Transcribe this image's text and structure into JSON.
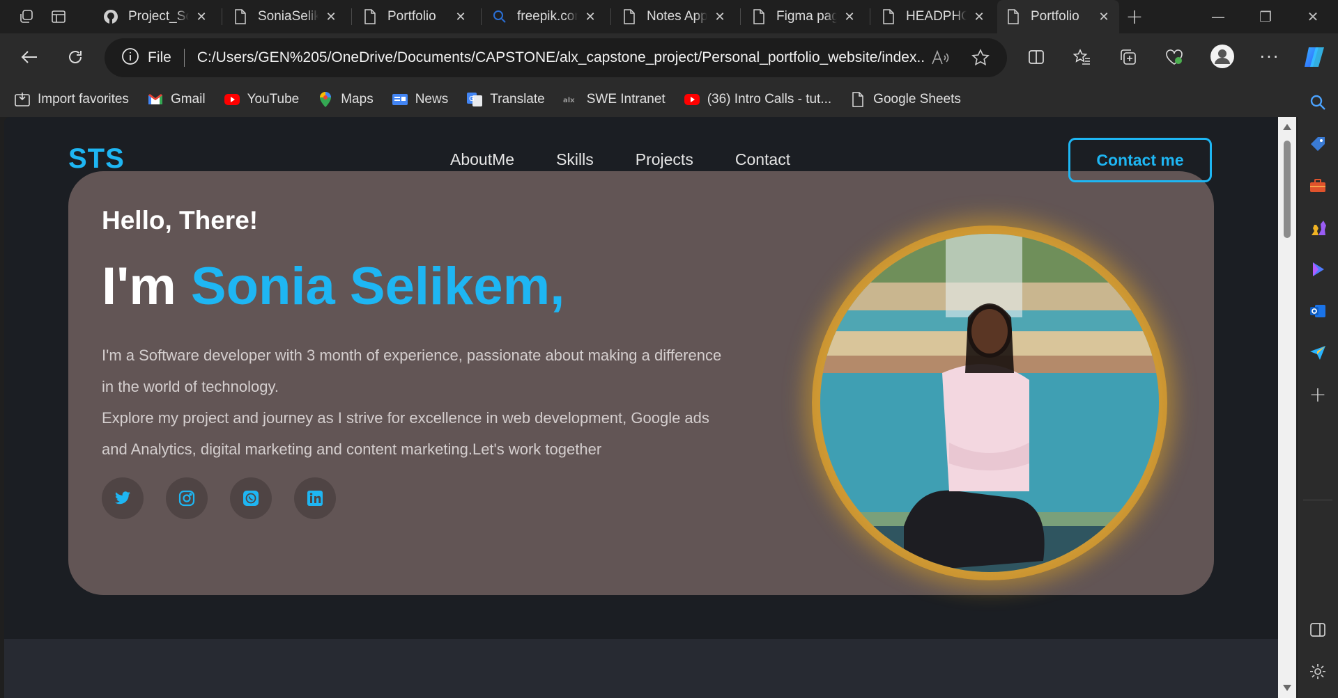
{
  "browser": {
    "tabs": [
      {
        "title": "Project_So",
        "icon": "github-icon",
        "active": false
      },
      {
        "title": "SoniaSelik",
        "icon": "page-icon",
        "active": false
      },
      {
        "title": "Portfolio",
        "icon": "page-icon",
        "active": false
      },
      {
        "title": "freepik.com",
        "icon": "search-icon",
        "active": false
      },
      {
        "title": "Notes App",
        "icon": "page-icon",
        "active": false
      },
      {
        "title": "Figma pag",
        "icon": "page-icon",
        "active": false
      },
      {
        "title": "HEADPHO",
        "icon": "page-icon",
        "active": false
      },
      {
        "title": "Portfolio",
        "icon": "page-icon",
        "active": true
      }
    ],
    "address": {
      "scheme_label": "File",
      "url": "C:/Users/GEN%205/OneDrive/Documents/CAPSTONE/alx_capstone_project/Personal_portfolio_website/index..."
    },
    "bookmarks": [
      {
        "label": "Import favorites",
        "icon": "import-icon"
      },
      {
        "label": "Gmail",
        "icon": "gmail-icon"
      },
      {
        "label": "YouTube",
        "icon": "youtube-icon"
      },
      {
        "label": "Maps",
        "icon": "maps-icon"
      },
      {
        "label": "News",
        "icon": "news-icon"
      },
      {
        "label": "Translate",
        "icon": "translate-icon"
      },
      {
        "label": "SWE Intranet",
        "icon": "alx-icon"
      },
      {
        "label": "(36) Intro Calls - tut...",
        "icon": "youtube-icon"
      },
      {
        "label": "Google Sheets",
        "icon": "page-icon"
      }
    ]
  },
  "site": {
    "logo": "STS",
    "nav": [
      "AboutMe",
      "Skills",
      "Projects",
      "Contact"
    ],
    "contact_button": "Contact me",
    "hero": {
      "greeting": "Hello, There!",
      "im": "I'm",
      "name": "Sonia Selikem,",
      "bio_lines": [
        "I'm a Software developer with 3 month of experience, passionate about making a difference",
        "in the world of technology.",
        "Explore my project and journey as I strive for excellence in web development, Google ads",
        "and Analytics, digital marketing and content marketing.Let's work together"
      ],
      "socials": [
        "twitter-icon",
        "instagram-icon",
        "whatsapp-icon",
        "linkedin-icon"
      ]
    }
  },
  "colors": {
    "accent": "#1eb6f3",
    "hero_bg": "#625555",
    "page_bg": "#1b1e23",
    "photo_ring": "#d8a23a"
  }
}
